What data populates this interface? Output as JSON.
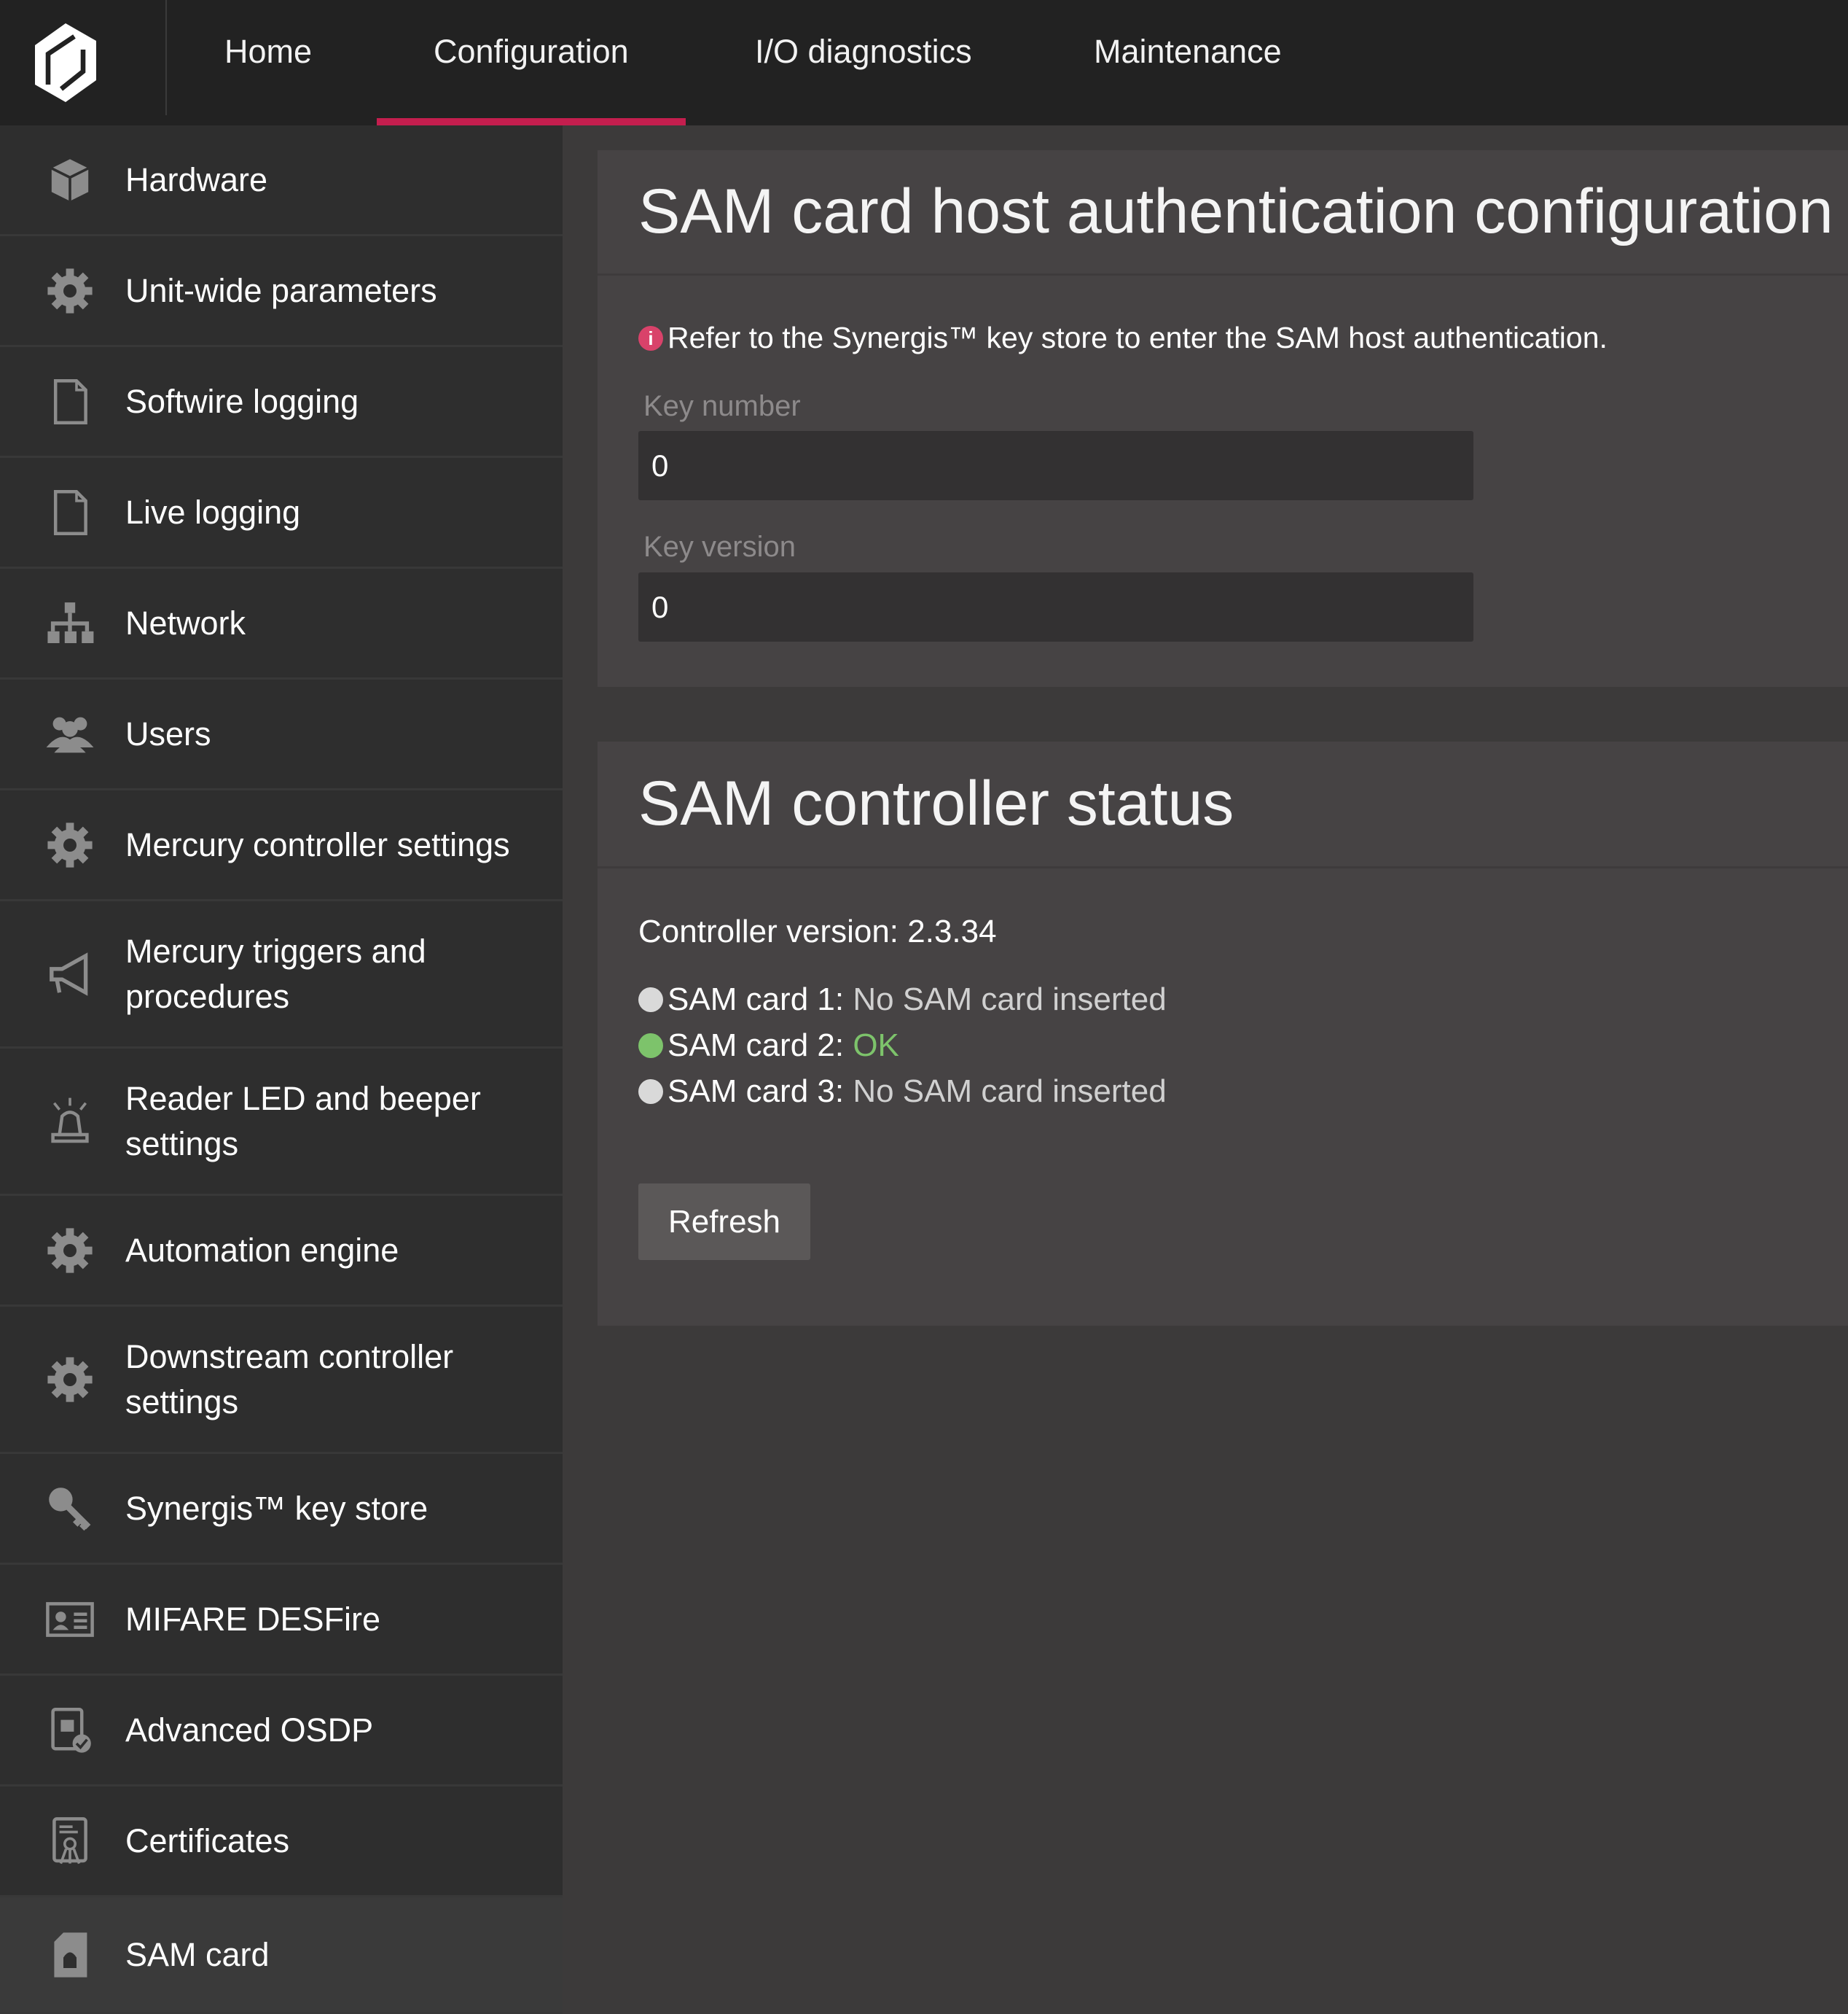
{
  "nav": {
    "items": [
      "Home",
      "Configuration",
      "I/O diagnostics",
      "Maintenance"
    ],
    "active": "Configuration"
  },
  "sidebar": {
    "items": [
      {
        "label": "Hardware",
        "icon": "cube-icon"
      },
      {
        "label": "Unit-wide parameters",
        "icon": "gear-icon"
      },
      {
        "label": "Softwire logging",
        "icon": "document-icon"
      },
      {
        "label": "Live logging",
        "icon": "document-icon"
      },
      {
        "label": "Network",
        "icon": "network-icon"
      },
      {
        "label": "Users",
        "icon": "users-icon"
      },
      {
        "label": "Mercury controller settings",
        "icon": "gear-icon"
      },
      {
        "label": "Mercury triggers and procedures",
        "icon": "megaphone-icon"
      },
      {
        "label": "Reader LED and beeper settings",
        "icon": "alarm-light-icon"
      },
      {
        "label": "Automation engine",
        "icon": "gear-icon"
      },
      {
        "label": "Downstream controller settings",
        "icon": "gear-icon"
      },
      {
        "label": "Synergis™ key store",
        "icon": "key-icon"
      },
      {
        "label": "MIFARE DESFire",
        "icon": "id-card-icon"
      },
      {
        "label": "Advanced OSDP",
        "icon": "secure-reader-icon"
      },
      {
        "label": "Certificates",
        "icon": "certificate-icon"
      },
      {
        "label": "SAM card",
        "icon": "sam-card-icon"
      }
    ],
    "active": "SAM card"
  },
  "auth": {
    "title": "SAM card host authentication configuration",
    "info": "Refer to the Synergis™ key store to enter the SAM host authentication.",
    "key_number_label": "Key number",
    "key_number": "0",
    "key_version_label": "Key version",
    "key_version": "0"
  },
  "status": {
    "title": "SAM controller status",
    "controller_version": "Controller version: 2.3.34",
    "cards": [
      {
        "label": "SAM card 1:",
        "value": "No SAM card inserted",
        "color": "#d9d9d9"
      },
      {
        "label": "SAM card 2:",
        "value": "OK",
        "color": "#7dc36b"
      },
      {
        "label": "SAM card 3:",
        "value": "No SAM card inserted",
        "color": "#d9d9d9"
      }
    ],
    "refresh": "Refresh"
  },
  "colors": {
    "accent": "#c41e4e",
    "ok": "#7dc36b",
    "info": "#d9426a"
  }
}
